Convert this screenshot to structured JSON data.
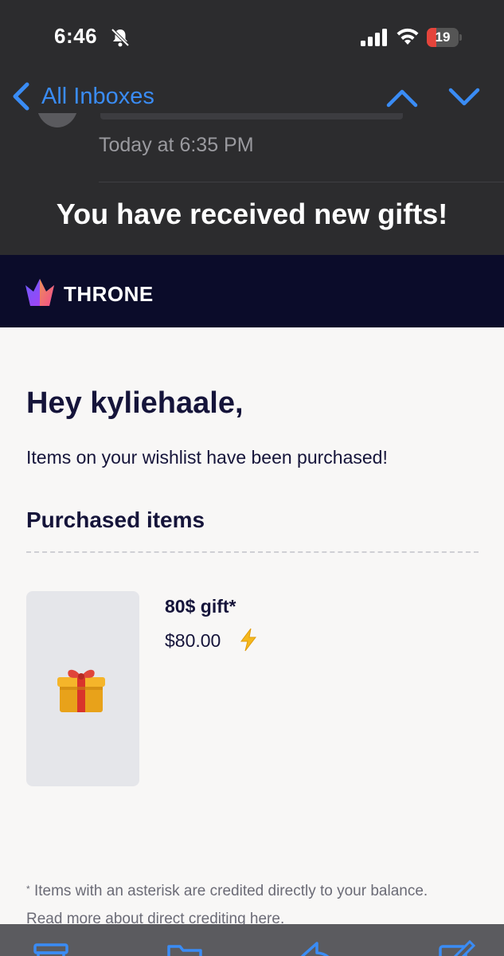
{
  "status_bar": {
    "time": "6:46",
    "battery": "19",
    "battery_color": "#e5443b"
  },
  "nav": {
    "back_label": "All Inboxes",
    "accent": "#3a8cf5",
    "up_icon": "chevron-up-icon",
    "down_icon": "chevron-down-icon"
  },
  "message": {
    "date": "Today at 6:35 PM",
    "subject": "You have received new gifts!"
  },
  "email": {
    "brand": "THRONE",
    "brand_bg": "#0b0c2a",
    "greeting": "Hey kyliehaale,",
    "intro": "Items on your wishlist have been purchased!",
    "section_title": "Purchased items",
    "items": [
      {
        "name": "80$ gift*",
        "price": "$80.00",
        "icon": "gift-icon",
        "badge_icon": "lightning-icon"
      }
    ],
    "footnote_mark": "*",
    "footnote_line1": "Items with an asterisk are credited directly to your balance.",
    "footnote_line2": "Read more about direct crediting here."
  },
  "toolbar": {
    "icons": [
      "archive-icon",
      "folder-icon",
      "reply-icon",
      "compose-icon"
    ]
  }
}
